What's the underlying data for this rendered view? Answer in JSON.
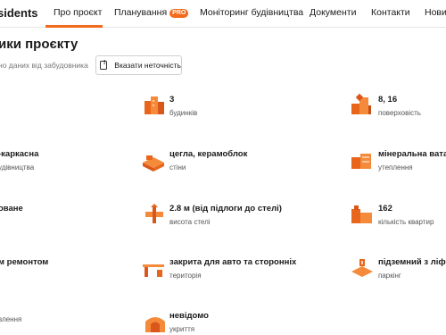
{
  "nav": {
    "brand": "sidents",
    "tabs": [
      {
        "label": "Про проєкт",
        "active": true
      },
      {
        "label": "Планування",
        "badge": "PRO"
      },
      {
        "label": "Моніторинг будівництва"
      },
      {
        "label": "Документи"
      },
      {
        "label": "Контакти"
      },
      {
        "label": "Нови"
      }
    ]
  },
  "section": {
    "title": "ики проєкту",
    "source": "но даних від забудовника",
    "report_button": "Вказати неточність"
  },
  "accent_color": "#f26a1b",
  "features": {
    "r1c1": {
      "value": "",
      "label": ""
    },
    "r1c2": {
      "value": "3",
      "label": "будинків",
      "icon": "buildings-icon"
    },
    "r1c3": {
      "value": "8, 16",
      "label": "поверховість",
      "icon": "floors-icon"
    },
    "r2c1": {
      "value": "-каркасна",
      "label": "удівництва"
    },
    "r2c2": {
      "value": "цегла, керамоблок",
      "label": "стіни",
      "icon": "bricks-icon"
    },
    "r2c3": {
      "value": "мінеральна вата",
      "label": "утеплення",
      "icon": "insulation-icon"
    },
    "r3c1": {
      "value": "оване",
      "label": ""
    },
    "r3c2": {
      "value": "2.8 м (від підлоги до стелі)",
      "label": "висота стелі",
      "icon": "ceiling-height-icon"
    },
    "r3c3": {
      "value": "162",
      "label": "кількість квартир",
      "icon": "apartments-icon"
    },
    "r4c1": {
      "value": "м ремонтом",
      "label": ""
    },
    "r4c2": {
      "value": "закрита для авто та сторонніх",
      "label": "територія",
      "icon": "barrier-icon"
    },
    "r4c3": {
      "value": "підземний з ліфт",
      "label": "паркінг",
      "icon": "parking-icon"
    },
    "r5c1": {
      "value": "",
      "label": "влення"
    },
    "r5c2": {
      "value": "невідомо",
      "label": "укриття",
      "icon": "shelter-icon"
    }
  }
}
